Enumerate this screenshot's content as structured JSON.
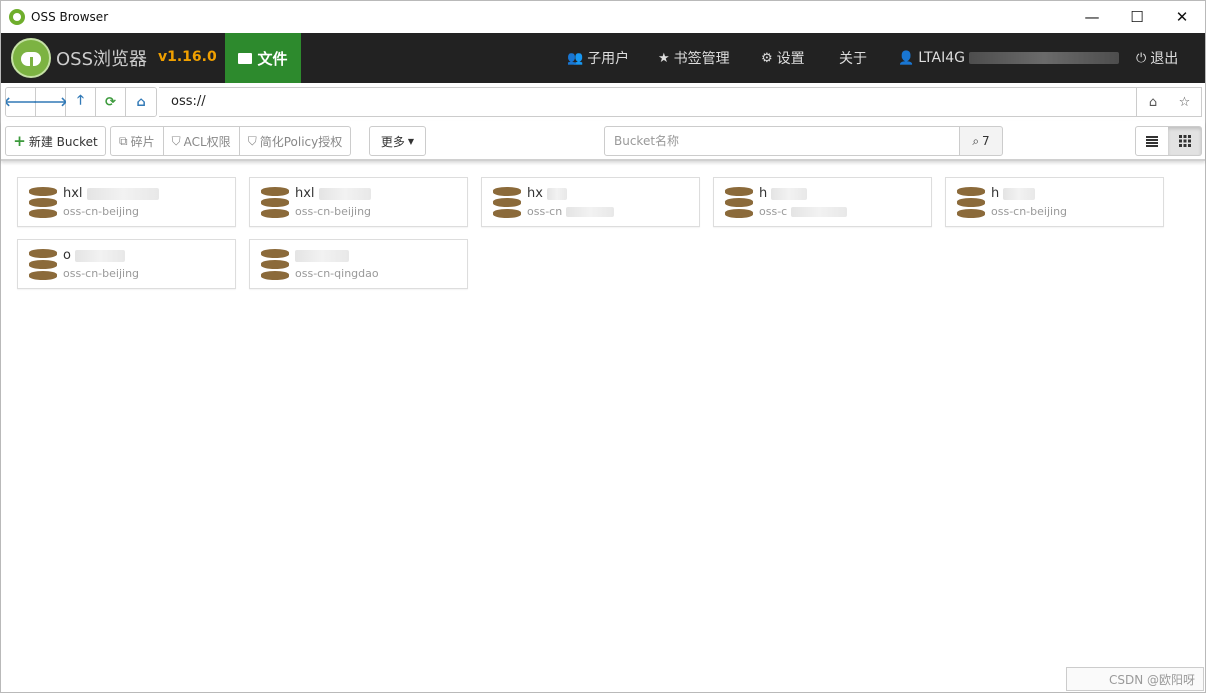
{
  "window": {
    "title": "OSS Browser",
    "minimize": "—",
    "maximize": "☐",
    "close": "✕"
  },
  "navbar": {
    "brand": "OSS浏览器",
    "version": "v1.16.0",
    "file_tab": "文件",
    "items": [
      {
        "icon": "users-icon",
        "glyph": "👥",
        "label": "子用户"
      },
      {
        "icon": "star-icon",
        "glyph": "★",
        "label": "书签管理"
      },
      {
        "icon": "gear-icon",
        "glyph": "⚙",
        "label": "设置"
      },
      {
        "icon": "",
        "glyph": "",
        "label": "关于"
      },
      {
        "icon": "user-icon",
        "glyph": "👤",
        "label": "LTAI4G"
      },
      {
        "icon": "power-icon",
        "glyph": "⏻",
        "label": "退出"
      }
    ]
  },
  "address": {
    "back": "🡐",
    "forward": "🡒",
    "up": "🡑",
    "refresh": "⟳",
    "home": "⌂",
    "value": "oss://",
    "home_right": "⌂",
    "bookmark": "☆"
  },
  "toolbar": {
    "new_bucket": "新建 Bucket",
    "fragments": "碎片",
    "acl": "ACL权限",
    "policy": "简化Policy授权",
    "more": "更多",
    "search_placeholder": "Bucket名称",
    "search_count": "7"
  },
  "buckets": [
    {
      "name": "hxl",
      "region": "oss-cn-beijing"
    },
    {
      "name": "hxl",
      "region": "oss-cn-beijing"
    },
    {
      "name": "hx",
      "region": "oss-cn"
    },
    {
      "name": "h",
      "region": "oss-c"
    },
    {
      "name": "h",
      "region": "oss-cn-beijing"
    },
    {
      "name": "o",
      "region": "oss-cn-beijing"
    },
    {
      "name": "",
      "region": "oss-cn-qingdao"
    }
  ],
  "status": {
    "text": "CSDN @欧阳呀"
  }
}
